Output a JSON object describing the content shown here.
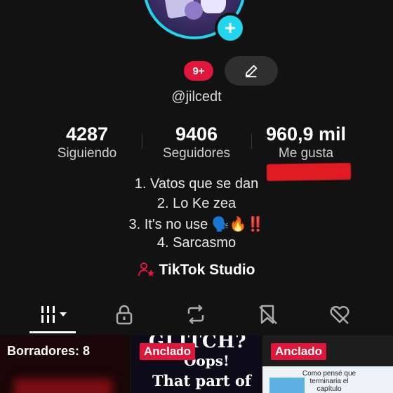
{
  "profile": {
    "notifications_badge": "9+",
    "username": "@jilcedt"
  },
  "stats": [
    {
      "value": "4287",
      "label": "Siguiendo"
    },
    {
      "value": "9406",
      "label": "Seguidores"
    },
    {
      "value": "960,9 mil",
      "label": "Me gusta"
    }
  ],
  "bio": [
    "1. Vatos que se dan",
    "2. Lo Ke zea",
    "3. It's no use 🗣️🔥‼️",
    "4. Sarcasmo"
  ],
  "studio": {
    "label": "TikTok Studio"
  },
  "tabs": [
    {
      "icon": "grid-icon",
      "active": true
    },
    {
      "icon": "lock-icon",
      "active": false
    },
    {
      "icon": "repost-icon",
      "active": false
    },
    {
      "icon": "saved-icon",
      "active": false
    },
    {
      "icon": "liked-icon",
      "active": false
    }
  ],
  "videos": [
    {
      "overlay": "Borradores: 8"
    },
    {
      "pinned": "Anclado",
      "caption_1": "GLITCH?",
      "caption_2": "Oops!",
      "caption_3": "That part of"
    },
    {
      "pinned": "Anclado",
      "caption": "Como pensé que terminaria el capítulo"
    }
  ],
  "colors": {
    "accent_cyan": "#20d5ec",
    "accent_red": "#e0163a",
    "background": "#121212"
  }
}
